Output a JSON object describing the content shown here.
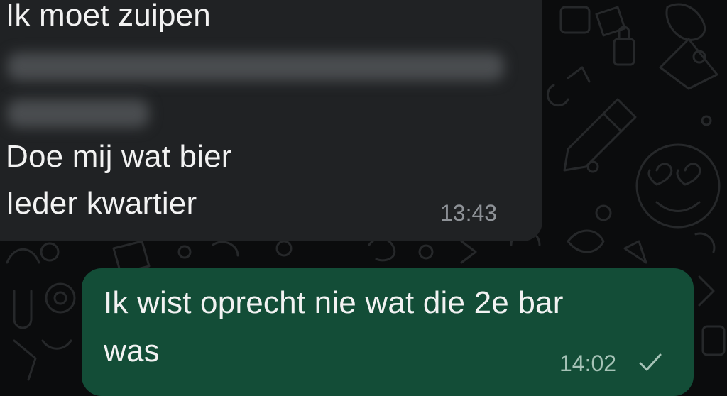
{
  "messages": [
    {
      "direction": "incoming",
      "lines": [
        "Ik moet zuipen",
        "Doe mij wat bier",
        "Ieder kwartier"
      ],
      "time": "13:43"
    },
    {
      "direction": "outgoing",
      "lines": [
        "Ik wist oprecht nie wat die 2e bar",
        "was"
      ],
      "time": "14:02",
      "status_icon": "single-check-icon"
    }
  ],
  "colors": {
    "background": "#0b0c0d",
    "incoming_bubble": "#202224",
    "outgoing_bubble": "#134d37",
    "text": "#f2f2f2",
    "incoming_time": "#8e9297",
    "outgoing_time": "#a6c3b7"
  }
}
